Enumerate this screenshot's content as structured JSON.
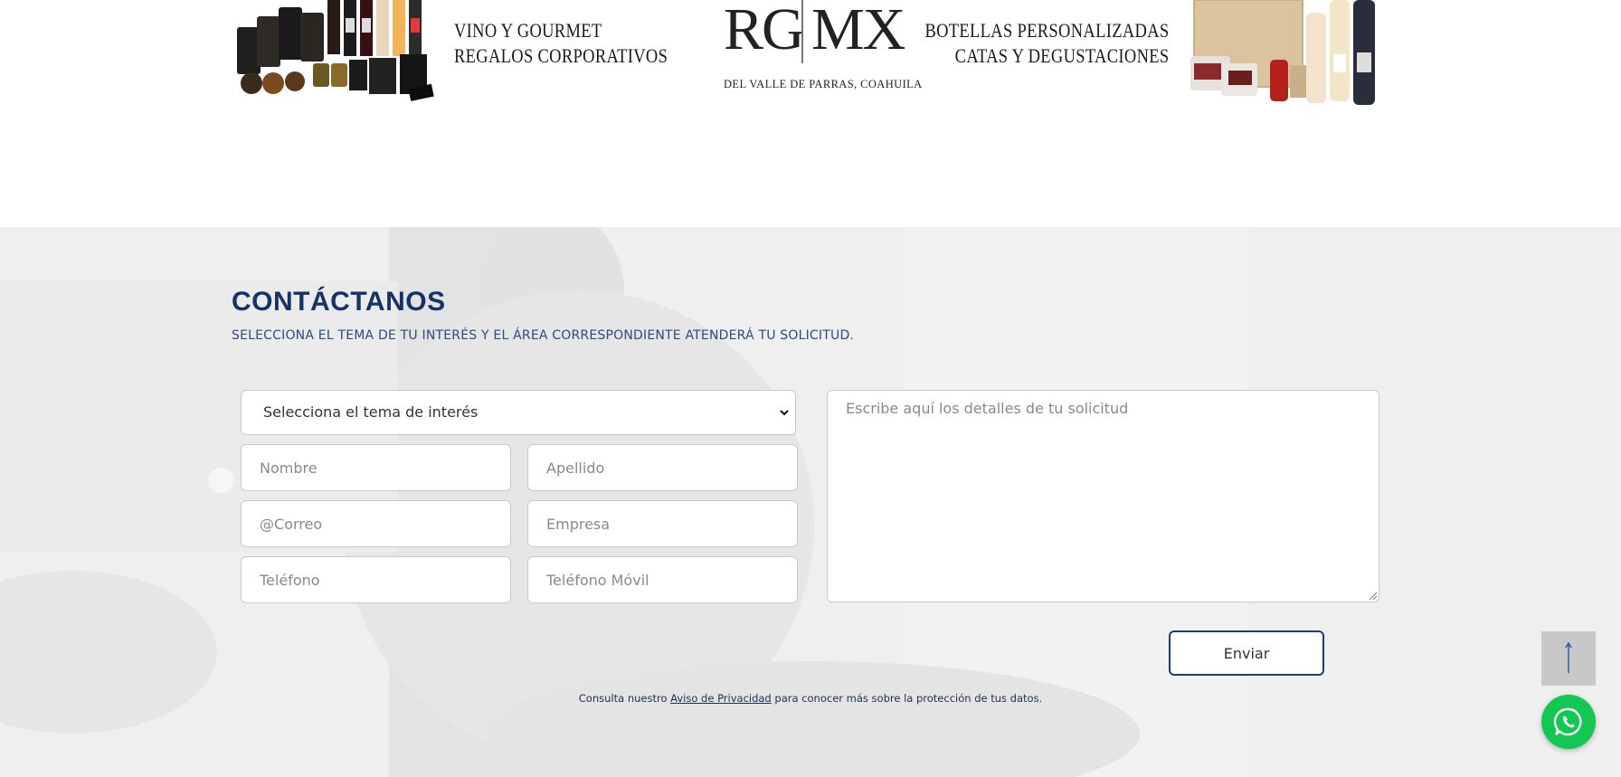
{
  "banner": {
    "left_text": [
      "VINO Y GOURMET",
      "REGALOS CORPORATIVOS"
    ],
    "logo": {
      "left": "RG",
      "right": "MX",
      "subtitle": "DEL VALLE DE PARRAS, COAHUILA"
    },
    "right_text": [
      "BOTELLAS PERSONALIZADAS",
      "CATAS Y DEGUSTACIONES"
    ]
  },
  "contact": {
    "title": "CONTÁCTANOS",
    "subtitle": "SELECCIONA EL TEMA DE TU INTERÉS Y EL ÁREA CORRESPONDIENTE ATENDERÁ TU SOLICITUD.",
    "topic_select": {
      "value": "Selecciona el tema de interés"
    },
    "fields": {
      "nombre": "Nombre",
      "apellido": "Apellido",
      "correo": "@Correo",
      "empresa": "Empresa",
      "telefono": "Teléfono",
      "telefono_movil": "Teléfono Móvil",
      "mensaje": "Escribe aquí los detalles de tu solicitud"
    },
    "submit_label": "Enviar",
    "privacy": {
      "before": "Consulta nuestro ",
      "link": "Aviso de Privacidad",
      "after": " para conocer más sobre la protección de tus datos."
    }
  },
  "colors": {
    "title": "#14336a",
    "button_border": "#1d3b78",
    "whatsapp": "#12c752",
    "scroll_top_bg": "#c8c8c8"
  },
  "icons": {
    "scroll_top": "arrow-up-icon",
    "whatsapp": "whatsapp-icon",
    "select": "chevron-down-icon"
  }
}
